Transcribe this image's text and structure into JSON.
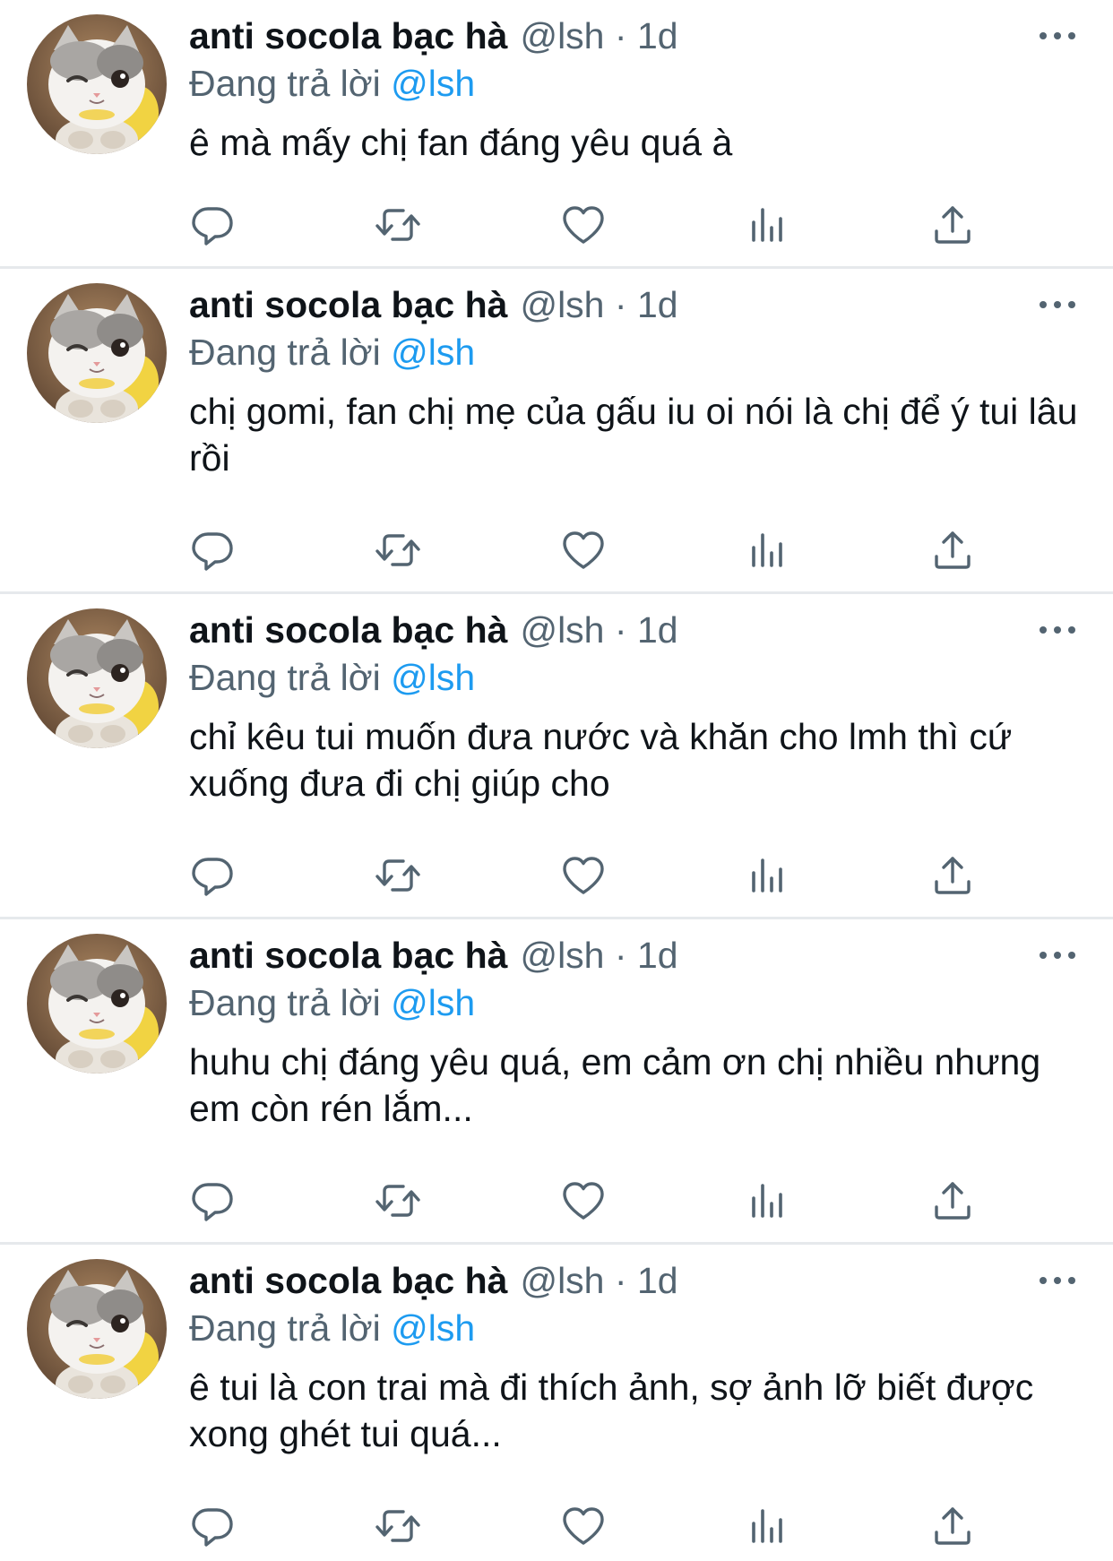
{
  "colors": {
    "accent": "#1d9bf0",
    "text_primary": "#0f1419",
    "text_secondary": "#536471",
    "divider": "#e6e9ec"
  },
  "icons": {
    "reply": "reply-icon",
    "retweet": "retweet-icon",
    "like": "heart-icon",
    "views": "analytics-icon",
    "share": "share-icon",
    "more": "more-icon"
  },
  "tweets": [
    {
      "author_name": "anti socola bạc hà",
      "handle": "@lsh",
      "separator": "·",
      "time": "1d",
      "reply_prefix": "Đang trả lời",
      "reply_to": "@lsh",
      "text": "ê mà mấy chị fan đáng yêu quá à"
    },
    {
      "author_name": "anti socola bạc hà",
      "handle": "@lsh",
      "separator": "·",
      "time": "1d",
      "reply_prefix": "Đang trả lời",
      "reply_to": "@lsh",
      "text": "chị gomi, fan chị mẹ của gấu iu oi nói là chị để ý tui lâu rồi"
    },
    {
      "author_name": "anti socola bạc hà",
      "handle": "@lsh",
      "separator": "·",
      "time": "1d",
      "reply_prefix": "Đang trả lời",
      "reply_to": "@lsh",
      "text": "chỉ kêu tui muốn đưa nước và khăn cho lmh thì cứ xuống đưa đi chị giúp cho"
    },
    {
      "author_name": "anti socola bạc hà",
      "handle": "@lsh",
      "separator": "·",
      "time": "1d",
      "reply_prefix": "Đang trả lời",
      "reply_to": "@lsh",
      "text": "huhu chị đáng yêu quá, em cảm ơn chị nhiều nhưng em còn rén lắm..."
    },
    {
      "author_name": "anti socola bạc hà",
      "handle": "@lsh",
      "separator": "·",
      "time": "1d",
      "reply_prefix": "Đang trả lời",
      "reply_to": "@lsh",
      "text": "ê tui là con trai mà đi thích ảnh, sợ ảnh lỡ biết được xong ghét tui quá..."
    }
  ]
}
